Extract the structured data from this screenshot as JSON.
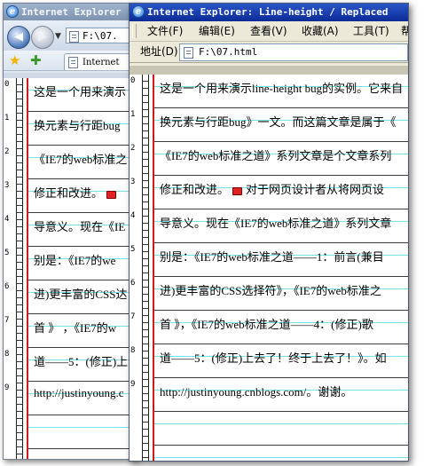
{
  "back_window": {
    "title": "Internet Explorer",
    "address": "F:\\07.",
    "tab_label": "Internet",
    "lines": [
      "这是一个用来演示",
      "换元素与行距bug",
      "《IE7的web标准之",
      "修正和改进。",
      "导意义。现在《IE",
      "别是：《IE7的we",
      "进)更丰富的CSS达",
      "首 》 ，《IE7的w",
      "道——5：(修正)上",
      "http://justinyoung.c"
    ]
  },
  "front_window": {
    "title": "Internet Explorer: Line-height / Replaced",
    "menus": [
      "文件(F)",
      "编辑(E)",
      "查看(V)",
      "收藏(A)",
      "工具(T)",
      "帮"
    ],
    "address_label": "地址(D)",
    "address": "F:\\07.html",
    "lines": [
      "这是一个用来演示line-height bug的实例。它来自",
      "换元素与行距bug》一文。而这篇文章是属于《",
      "《IE7的web标准之道》系列文章是个文章系列",
      "修正和改进。",
      "导意义。现在《IE7的web标准之道》系列文章",
      "别是：《IE7的web标准之道——1：前言(兼目",
      "进)更丰富的CSS选择符》，《IE7的web标准之",
      "首 》，《IE7的web标准之道——4：(修正)歌",
      "道——5：(修正)上去了！终于上去了！》。如",
      "http://justinyoung.cnblogs.com/。谢谢。"
    ],
    "line4_tail": "对于网页设计者从将网页设"
  },
  "ruler_numbers": [
    "0",
    "1",
    "2",
    "3",
    "4",
    "5",
    "6",
    "7",
    "8",
    "9"
  ]
}
